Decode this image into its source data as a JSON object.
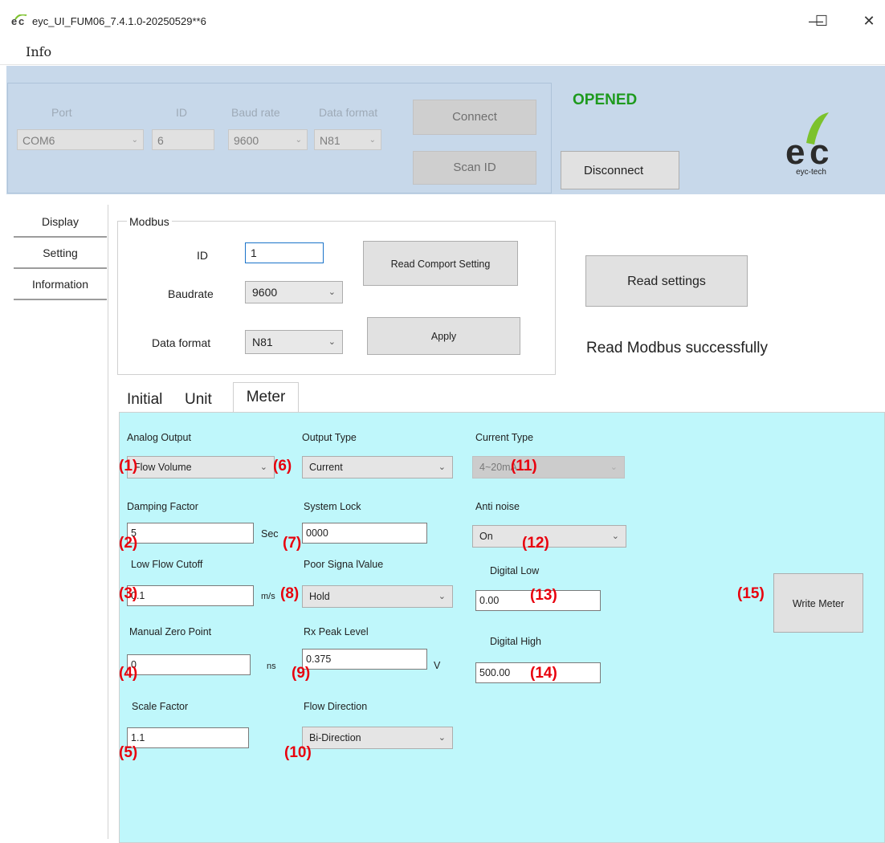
{
  "window": {
    "title": "eyc_UI_FUM06_7.4.1.0-20250529**6",
    "minimize": "—",
    "maximize": "☐",
    "close": "✕",
    "menu": [
      "Info"
    ]
  },
  "connection": {
    "labels": {
      "port": "Port",
      "id": "ID",
      "baud": "Baud rate",
      "format": "Data format"
    },
    "port": "COM6",
    "id": "6",
    "baud": "9600",
    "format": "N81",
    "connect_label": "Connect",
    "scan_label": "Scan ID",
    "status": "OPENED",
    "disconnect_label": "Disconnect",
    "logo_text": "eyc-tech",
    "status_color": "#1e9a1e"
  },
  "nav": {
    "items": [
      "Display",
      "Setting",
      "Information"
    ]
  },
  "modbus": {
    "legend": "Modbus",
    "id_label": "ID",
    "id_value": "1",
    "baud_label": "Baudrate",
    "baud_value": "9600",
    "format_label": "Data format",
    "format_value": "N81",
    "read_comport_label": "Read Comport Setting",
    "apply_label": "Apply",
    "read_settings_label": "Read settings",
    "status_text": "Read Modbus successfully"
  },
  "tabs": [
    "Initial",
    "Unit",
    "Meter"
  ],
  "meter": {
    "analog_output": {
      "label": "Analog Output",
      "value": "Flow Volume",
      "marker": "(1)"
    },
    "damping": {
      "label": "Damping Factor",
      "value": "5",
      "unit": "Sec",
      "marker": "(2)"
    },
    "low_flow": {
      "label": "Low Flow Cutoff",
      "value": "0.1",
      "unit": "m/s",
      "marker": "(3)"
    },
    "zero_point": {
      "label": "Manual Zero Point",
      "value": "0",
      "unit": "ns",
      "marker": "(4)"
    },
    "scale": {
      "label": "Scale Factor",
      "value": "1.1",
      "marker": "(5)"
    },
    "output_type": {
      "label": "Output Type",
      "value": "Current",
      "marker": "(6)"
    },
    "system_lock": {
      "label": "System Lock",
      "value": "0000",
      "marker": "(7)"
    },
    "poor_signal": {
      "label": "Poor Signa lValue",
      "value": "Hold",
      "marker": "(8)"
    },
    "rx_peak": {
      "label": "Rx Peak Level",
      "value": "0.375",
      "unit": "V",
      "marker": "(9)"
    },
    "flow_dir": {
      "label": "Flow Direction",
      "value": "Bi-Direction",
      "marker": "(10)"
    },
    "current_type": {
      "label": "Current Type",
      "value": "4~20mA",
      "marker": "(11)"
    },
    "anti_noise": {
      "label": "Anti noise",
      "value": "On",
      "marker": "(12)"
    },
    "digital_low": {
      "label": "Digital Low",
      "value": "0.00",
      "marker": "(13)"
    },
    "digital_high": {
      "label": "Digital High",
      "value": "500.00",
      "marker": "(14)"
    },
    "write_meter": {
      "label": "Write Meter",
      "marker": "(15)"
    },
    "marker_color": "#e8000d",
    "panel_color": "#bff7fb"
  }
}
